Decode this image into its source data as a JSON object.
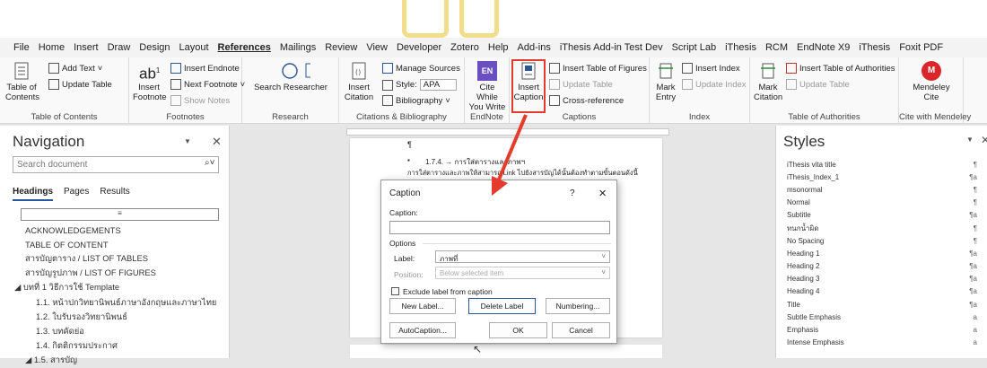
{
  "menubar": {
    "tabs": [
      "File",
      "Home",
      "Insert",
      "Draw",
      "Design",
      "Layout",
      "References",
      "Mailings",
      "Review",
      "View",
      "Developer",
      "Zotero",
      "Help",
      "Add-ins",
      "iThesis Add-in Test Dev",
      "Script Lab",
      "iThesis",
      "RCM",
      "EndNote X9",
      "iThesis",
      "Foxit PDF"
    ],
    "active_tab": "References"
  },
  "ribbon": {
    "toc": {
      "table_of_contents": "Table of Contents",
      "add_text": "Add Text",
      "update_table": "Update Table",
      "group": "Table of Contents"
    },
    "footnotes": {
      "insert_footnote": "Insert Footnote",
      "insert_endnote": "Insert Endnote",
      "next_footnote": "Next Footnote",
      "show_notes": "Show Notes",
      "group": "Footnotes"
    },
    "research": {
      "search_researcher": "Search Researcher",
      "group": "Research"
    },
    "citations": {
      "insert_citation": "Insert Citation",
      "manage_sources": "Manage Sources",
      "style_label": "Style:",
      "style_value": "APA",
      "bibliography": "Bibliography",
      "group": "Citations & Bibliography"
    },
    "endnote": {
      "cite_while_you_write": "Cite While You Write",
      "group": "EndNote"
    },
    "captions": {
      "insert_caption": "Insert Caption",
      "insert_table_of_figures": "Insert Table of Figures",
      "update_table": "Update Table",
      "cross_reference": "Cross-reference",
      "group": "Captions"
    },
    "index": {
      "mark_entry": "Mark Entry",
      "insert_index": "Insert Index",
      "update_index": "Update Index",
      "group": "Index"
    },
    "authorities": {
      "mark_citation": "Mark Citation",
      "insert_table_of_authorities": "Insert Table of Authorities",
      "update_table": "Update Table",
      "group": "Table of Authorities"
    },
    "mendeley": {
      "mendeley_cite": "Mendeley Cite",
      "group": "Cite with Mendeley"
    }
  },
  "navigation": {
    "title": "Navigation",
    "search_placeholder": "Search document",
    "tabs": [
      "Headings",
      "Pages",
      "Results"
    ],
    "active_tab": "Headings",
    "items": [
      "ACKNOWLEDGEMENTS",
      "TABLE OF CONTENT",
      "สารบัญตาราง / LIST OF TABLES",
      "สารบัญรูปภาพ / LIST OF FIGURES",
      "◢ บทที่ 1  วิธีการใช้ Template",
      "1.1. หน้าปกวิทยานิพนธ์ภาษาอังกฤษและภาษาไทย",
      "1.2. ใบรับรองวิทยานิพนธ์",
      "1.3. บทคัดย่อ",
      "1.4. กิตติกรรมประกาศ",
      "◢ 1.5. สารบัญ"
    ]
  },
  "document": {
    "pilcrow": "¶",
    "line1": "1.7.4. → การใส่ตารางและภาพฯ",
    "line2": "การใส่ตารางและภาพให้สามารถ Link ไปยังสารบัญได้นั้นต้องทำตามขั้นตอนดังนี้"
  },
  "dialog": {
    "title": "Caption",
    "help": "?",
    "close": "✕",
    "caption_label": "Caption:",
    "caption_value": "",
    "options_label": "Options",
    "label_label": "Label:",
    "label_value": "ภาพที่",
    "position_label": "Position:",
    "position_value": "Below selected item",
    "exclude_label": "Exclude label from caption",
    "new_label": "New Label...",
    "delete_label": "Delete Label",
    "numbering": "Numbering...",
    "autocaption": "AutoCaption...",
    "ok": "OK",
    "cancel": "Cancel"
  },
  "styles": {
    "title": "Styles",
    "items": [
      {
        "name": "iThesis vita title",
        "mark": "¶"
      },
      {
        "name": "iThesis_Index_1",
        "mark": "¶a"
      },
      {
        "name": "msonormal",
        "mark": "¶"
      },
      {
        "name": "Normal",
        "mark": "¶"
      },
      {
        "name": "Subtitle",
        "mark": "¶a"
      },
      {
        "name": "ทนกน้ำผิด",
        "mark": "¶"
      },
      {
        "name": "No Spacing",
        "mark": "¶"
      },
      {
        "name": "Heading 1",
        "mark": "¶a"
      },
      {
        "name": "Heading 2",
        "mark": "¶a"
      },
      {
        "name": "Heading 3",
        "mark": "¶a"
      },
      {
        "name": "Heading 4",
        "mark": "¶a"
      },
      {
        "name": "Title",
        "mark": "¶a"
      },
      {
        "name": "Subtle Emphasis",
        "mark": "a"
      },
      {
        "name": "Emphasis",
        "mark": "a"
      },
      {
        "name": "Intense Emphasis",
        "mark": "a"
      }
    ]
  },
  "colors": {
    "accent": "#2b579a",
    "highlight": "#e33b2e",
    "endnote": "#6a4fc0",
    "mendeley": "#d9262a"
  }
}
